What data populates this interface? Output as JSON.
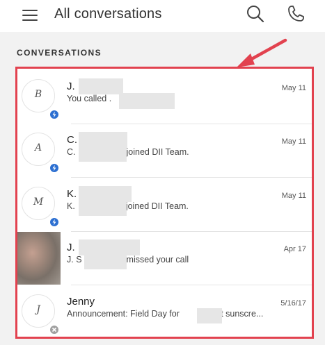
{
  "header": {
    "title": "All conversations",
    "menu_icon": "hamburger-menu-icon",
    "search_icon": "search-icon",
    "call_icon": "phone-icon"
  },
  "section": {
    "label": "CONVERSATIONS"
  },
  "colors": {
    "highlight_border": "#e2424f",
    "badge_blue": "#2c6fd1",
    "badge_gray": "#a0a0a0"
  },
  "conversations": [
    {
      "initial": "B",
      "name": "J.",
      "preview": "You called .",
      "date": "May 11",
      "badge": "blue"
    },
    {
      "initial": "A",
      "name": "C.",
      "preview_prefix": "C.",
      "preview_suffix": "joined DII Team.",
      "date": "May 11",
      "badge": "blue"
    },
    {
      "initial": "M",
      "name": "K.",
      "preview_prefix": "K.",
      "preview_suffix": "joined DII Team.",
      "date": "May 11",
      "badge": "blue"
    },
    {
      "initial": "",
      "name": "J.",
      "preview_prefix": "J. S",
      "preview_suffix": "missed your call",
      "date": "Apr 17",
      "badge": "none"
    },
    {
      "initial": "J",
      "name": "Jenny",
      "preview_prefix": "Announcement: Field Day for",
      "preview_suffix": "Put sunscre...",
      "date": "5/16/17",
      "badge": "gray"
    }
  ]
}
